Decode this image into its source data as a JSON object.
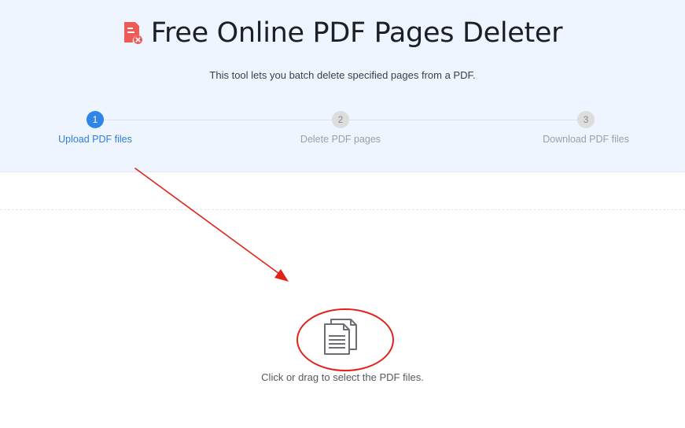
{
  "header": {
    "title": "Free Online PDF Pages Deleter",
    "subtitle": "This tool lets you batch delete specified pages from a PDF.",
    "icon": "pdf-delete-icon"
  },
  "steps": [
    {
      "number": "1",
      "label": "Upload PDF files",
      "active": true
    },
    {
      "number": "2",
      "label": "Delete PDF pages",
      "active": false
    },
    {
      "number": "3",
      "label": "Download PDF files",
      "active": false
    }
  ],
  "upload": {
    "icon": "files-icon",
    "text": "Click or drag to select the PDF files."
  },
  "annotations": {
    "arrow": "red-arrow",
    "ellipse": "red-ellipse"
  },
  "colors": {
    "accent": "#2f85e8",
    "hero_bg": "#eef5fe",
    "annotation": "#e2231a",
    "icon_red": "#ef5a57"
  }
}
